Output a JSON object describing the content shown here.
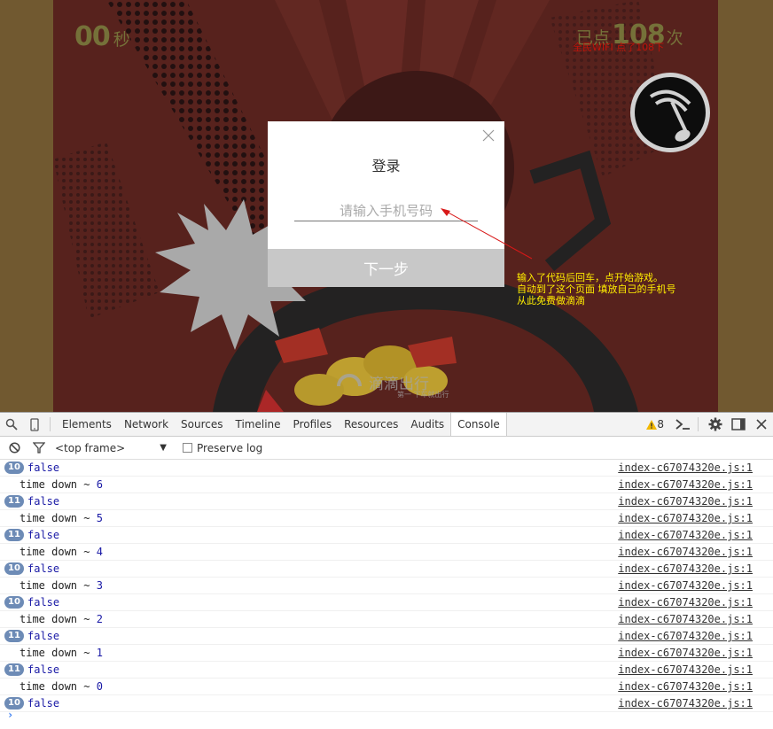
{
  "game": {
    "timer_value": "00",
    "timer_unit": "秒",
    "score_prefix": "已点",
    "score_value": "108",
    "score_unit": "次",
    "score_overlay": "全民WIFI 点了108下",
    "watermark_text": "滴滴出行",
    "watermark_sub": "第一 下车就出行",
    "music_icon": "music-note-icon"
  },
  "modal": {
    "title": "登录",
    "phone_placeholder": "请输入手机号码",
    "next_label": "下一步",
    "close_icon": "close-icon"
  },
  "annotation": {
    "lines": [
      "输入了代码后回车，点开始游戏。",
      "自动到了这个页面 填放自己的手机号",
      "从此免费做滴滴"
    ],
    "color": "#ffee00"
  },
  "devtools": {
    "tabs": [
      "Elements",
      "Network",
      "Sources",
      "Timeline",
      "Profiles",
      "Resources",
      "Audits",
      "Console"
    ],
    "active_tab": "Console",
    "warning_count": "8",
    "frame": "<top frame>",
    "preserve_log_label": "Preserve log",
    "prompt": "›"
  },
  "console": {
    "rows": [
      {
        "count": "10",
        "text": "false",
        "src": "index-c67074320e.js:1"
      },
      {
        "count": "",
        "text": "time down ~ ",
        "num": "6",
        "src": "index-c67074320e.js:1"
      },
      {
        "count": "11",
        "text": "false",
        "src": "index-c67074320e.js:1"
      },
      {
        "count": "",
        "text": "time down ~ ",
        "num": "5",
        "src": "index-c67074320e.js:1"
      },
      {
        "count": "11",
        "text": "false",
        "src": "index-c67074320e.js:1"
      },
      {
        "count": "",
        "text": "time down ~ ",
        "num": "4",
        "src": "index-c67074320e.js:1"
      },
      {
        "count": "10",
        "text": "false",
        "src": "index-c67074320e.js:1"
      },
      {
        "count": "",
        "text": "time down ~ ",
        "num": "3",
        "src": "index-c67074320e.js:1"
      },
      {
        "count": "10",
        "text": "false",
        "src": "index-c67074320e.js:1"
      },
      {
        "count": "",
        "text": "time down ~ ",
        "num": "2",
        "src": "index-c67074320e.js:1"
      },
      {
        "count": "11",
        "text": "false",
        "src": "index-c67074320e.js:1"
      },
      {
        "count": "",
        "text": "time down ~ ",
        "num": "1",
        "src": "index-c67074320e.js:1"
      },
      {
        "count": "11",
        "text": "false",
        "src": "index-c67074320e.js:1"
      },
      {
        "count": "",
        "text": "time down ~ ",
        "num": "0",
        "src": "index-c67074320e.js:1"
      },
      {
        "count": "10",
        "text": "false",
        "src": "index-c67074320e.js:1"
      }
    ]
  }
}
